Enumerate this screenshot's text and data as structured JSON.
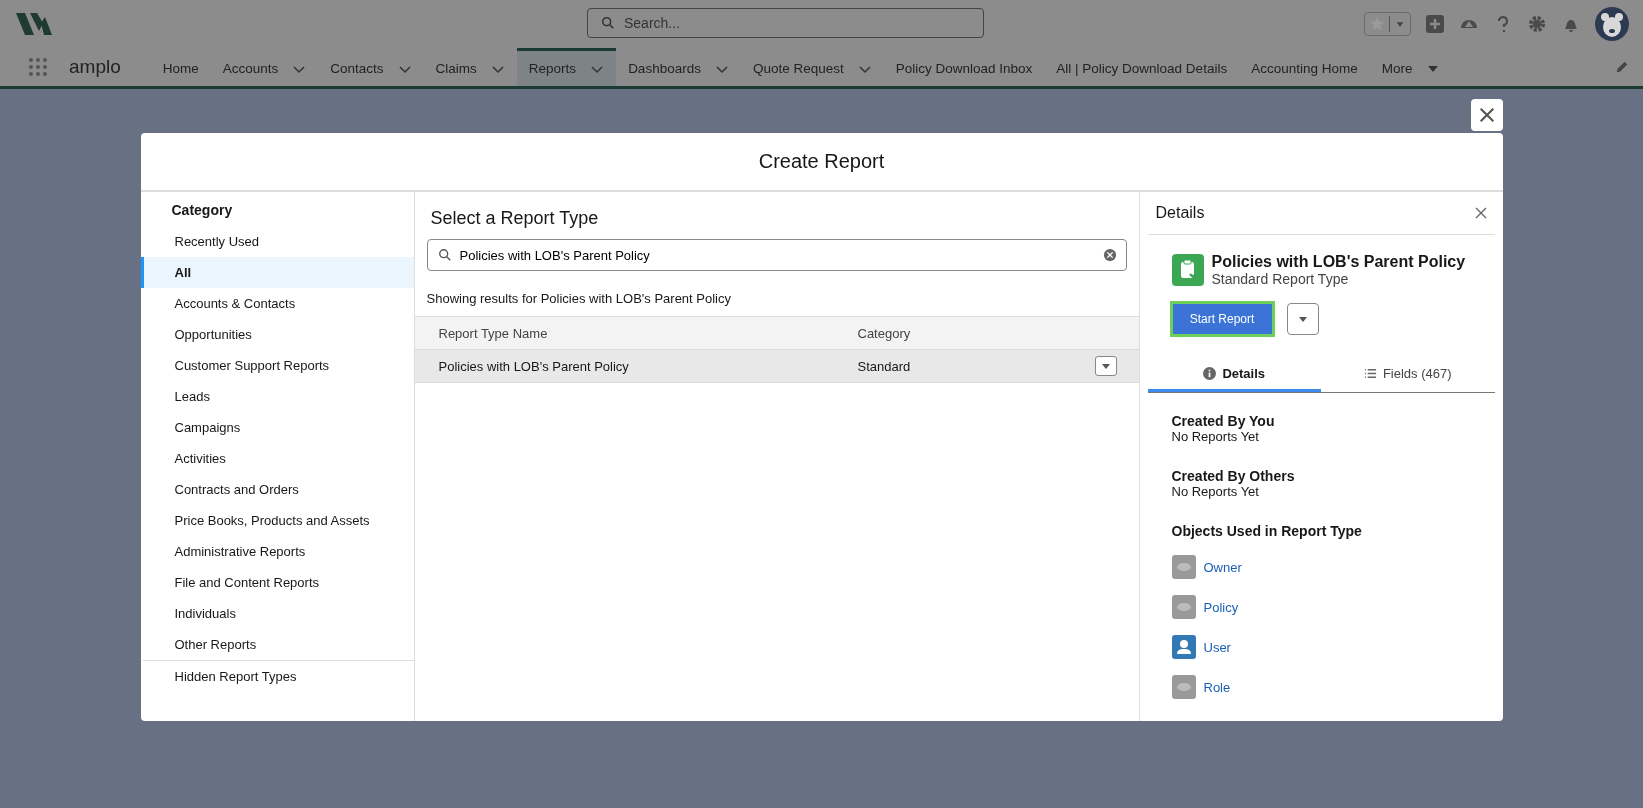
{
  "header": {
    "search": {
      "placeholder": "Search..."
    },
    "app_name": "amplo",
    "nav": [
      {
        "label": "Home",
        "kind": "plain",
        "selected": false
      },
      {
        "label": "Accounts",
        "kind": "menu",
        "selected": false
      },
      {
        "label": "Contacts",
        "kind": "menu",
        "selected": false
      },
      {
        "label": "Claims",
        "kind": "menu",
        "selected": false
      },
      {
        "label": "Reports",
        "kind": "menu",
        "selected": true
      },
      {
        "label": "Dashboards",
        "kind": "menu",
        "selected": false
      },
      {
        "label": "Quote Request",
        "kind": "menu",
        "selected": false
      },
      {
        "label": "Policy Download Inbox",
        "kind": "plain",
        "selected": false
      },
      {
        "label": "All | Policy Download Details",
        "kind": "plain",
        "selected": false
      },
      {
        "label": "Accounting Home",
        "kind": "plain",
        "selected": false
      },
      {
        "label": "More",
        "kind": "more",
        "selected": false
      }
    ]
  },
  "modal": {
    "title": "Create Report",
    "categories": {
      "heading": "Category",
      "items": [
        {
          "label": "Recently Used",
          "selected": false
        },
        {
          "label": "All",
          "selected": true
        },
        {
          "label": "Accounts & Contacts",
          "selected": false
        },
        {
          "label": "Opportunities",
          "selected": false
        },
        {
          "label": "Customer Support Reports",
          "selected": false
        },
        {
          "label": "Leads",
          "selected": false
        },
        {
          "label": "Campaigns",
          "selected": false
        },
        {
          "label": "Activities",
          "selected": false
        },
        {
          "label": "Contracts and Orders",
          "selected": false
        },
        {
          "label": "Price Books, Products and Assets",
          "selected": false
        },
        {
          "label": "Administrative Reports",
          "selected": false
        },
        {
          "label": "File and Content Reports",
          "selected": false
        },
        {
          "label": "Individuals",
          "selected": false
        },
        {
          "label": "Other Reports",
          "selected": false
        }
      ],
      "footer_item": {
        "label": "Hidden Report Types",
        "selected": false
      }
    },
    "report_types": {
      "title": "Select a Report Type",
      "search_value": "Policies with LOB's Parent Policy",
      "results_note": "Showing results for Policies with LOB's Parent Policy",
      "columns": [
        "Report Type Name",
        "Category"
      ],
      "rows": [
        {
          "name": "Policies with LOB's Parent Policy",
          "category": "Standard",
          "selected": true
        }
      ]
    },
    "details": {
      "title": "Details",
      "name": "Policies with LOB's Parent Policy",
      "subtitle": "Standard Report Type",
      "start_button": "Start Report",
      "tabs": [
        {
          "label": "Details",
          "kind": "info",
          "selected": true
        },
        {
          "label": "Fields (467)",
          "kind": "list",
          "selected": false
        }
      ],
      "sections": [
        {
          "heading": "Created By You",
          "text": "No Reports Yet"
        },
        {
          "heading": "Created By Others",
          "text": "No Reports Yet"
        }
      ],
      "objects_heading": "Objects Used in Report Type",
      "objects": [
        {
          "label": "Owner",
          "kind": "generic"
        },
        {
          "label": "Policy",
          "kind": "generic"
        },
        {
          "label": "User",
          "kind": "user"
        },
        {
          "label": "Role",
          "kind": "generic"
        }
      ]
    }
  }
}
